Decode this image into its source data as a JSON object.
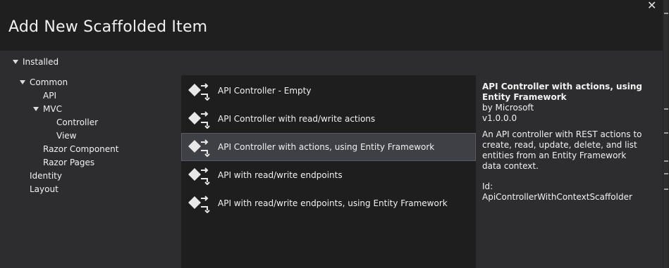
{
  "dialog": {
    "title": "Add New Scaffolded Item",
    "close_glyph": "✕"
  },
  "tree": {
    "installed_label": "Installed",
    "common_label": "Common",
    "api_label": "API",
    "mvc_label": "MVC",
    "controller_label": "Controller",
    "view_label": "View",
    "razor_component_label": "Razor Component",
    "razor_pages_label": "Razor Pages",
    "identity_label": "Identity",
    "layout_label": "Layout"
  },
  "templates": [
    {
      "label": "API Controller - Empty",
      "icon": "controller-icon",
      "selected": false
    },
    {
      "label": "API Controller with read/write actions",
      "icon": "controller-icon",
      "selected": false
    },
    {
      "label": "API Controller with actions, using Entity Framework",
      "icon": "controller-icon",
      "selected": true
    },
    {
      "label": "API with read/write endpoints",
      "icon": "controller-icon",
      "selected": false
    },
    {
      "label": "API with read/write endpoints, using Entity Framework",
      "icon": "controller-icon",
      "selected": false
    }
  ],
  "details": {
    "name": "API Controller with actions, using Entity Framework",
    "author": "by Microsoft",
    "version": "v1.0.0.0",
    "description": "An API controller with REST actions to create, read, update, delete, and list entities from an Entity Framework data context.",
    "id": "Id: ApiControllerWithContextScaffolder"
  },
  "colors": {
    "background": "#2d2d30",
    "header": "#1f1f1f",
    "list_background": "#1e1e1e",
    "selected_item": "#3f3f46"
  }
}
